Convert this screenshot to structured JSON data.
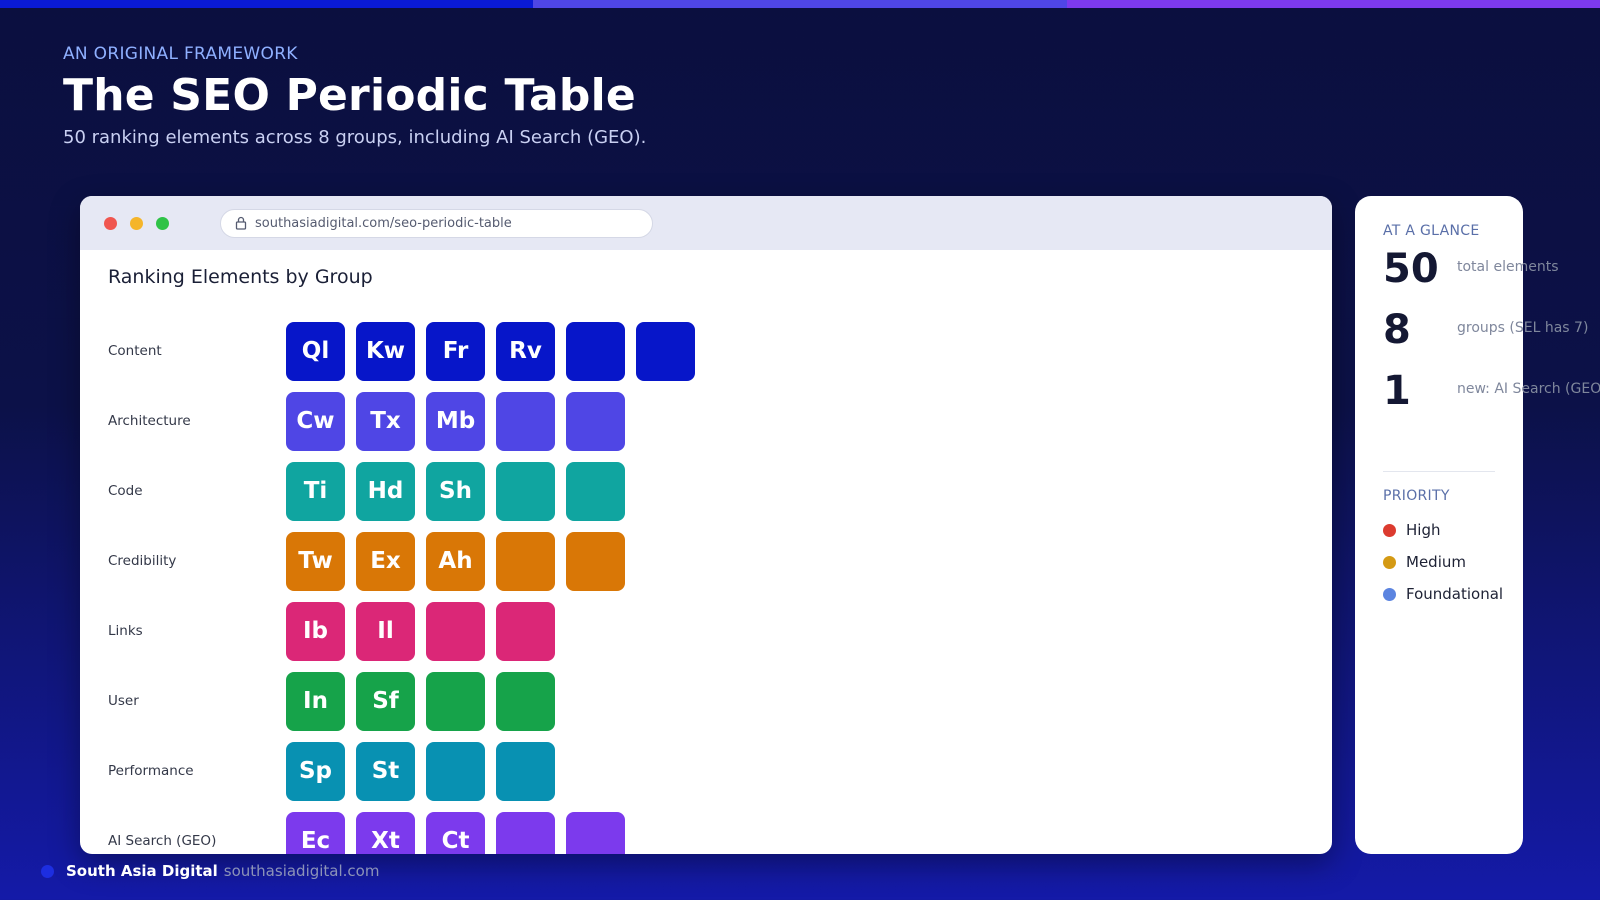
{
  "colors": {
    "strip": [
      "#0a1ad6",
      "#4f46e5",
      "#7c3aed"
    ],
    "content": "#0716c9",
    "architecture": "#4f46e5",
    "code": "#10a5a0",
    "credibility": "#d97706",
    "links": "#db2777",
    "user": "#16a34a",
    "performance": "#0891b2",
    "ai": "#7c3aed"
  },
  "header": {
    "eyebrow": "AN ORIGINAL FRAMEWORK",
    "title": "The SEO Periodic Table",
    "subtitle": "50 ranking elements across 8 groups, including AI Search (GEO)."
  },
  "browser": {
    "url": "southasiadigital.com/seo-periodic-table",
    "panel_title": "Ranking Elements by Group",
    "groups": [
      {
        "label": "Content",
        "color_key": "content",
        "tiles": [
          "Ql",
          "Kw",
          "Fr",
          "Rv",
          "",
          ""
        ]
      },
      {
        "label": "Architecture",
        "color_key": "architecture",
        "tiles": [
          "Cw",
          "Tx",
          "Mb",
          "",
          ""
        ]
      },
      {
        "label": "Code",
        "color_key": "code",
        "tiles": [
          "Ti",
          "Hd",
          "Sh",
          "",
          ""
        ]
      },
      {
        "label": "Credibility",
        "color_key": "credibility",
        "tiles": [
          "Tw",
          "Ex",
          "Ah",
          "",
          ""
        ]
      },
      {
        "label": "Links",
        "color_key": "links",
        "tiles": [
          "Ib",
          "Il",
          "",
          ""
        ]
      },
      {
        "label": "User",
        "color_key": "user",
        "tiles": [
          "In",
          "Sf",
          "",
          ""
        ]
      },
      {
        "label": "Performance",
        "color_key": "performance",
        "tiles": [
          "Sp",
          "St",
          "",
          ""
        ]
      },
      {
        "label": "AI Search (GEO)",
        "color_key": "ai",
        "tiles": [
          "Ec",
          "Xt",
          "Ct",
          "",
          ""
        ]
      }
    ]
  },
  "sidebar": {
    "glance_heading": "AT A GLANCE",
    "stats": [
      {
        "value": "50",
        "label": "total elements"
      },
      {
        "value": "8",
        "label": "groups (SEL has 7)"
      },
      {
        "value": "1",
        "label": "new: AI Search (GEO)"
      }
    ],
    "priority_heading": "PRIORITY",
    "priorities": [
      {
        "label": "High",
        "color": "#dc3b2f"
      },
      {
        "label": "Medium",
        "color": "#d49a14"
      },
      {
        "label": "Foundational",
        "color": "#5b84e0"
      }
    ]
  },
  "footer": {
    "brand": "South Asia Digital",
    "url": "southasiadigital.com"
  }
}
